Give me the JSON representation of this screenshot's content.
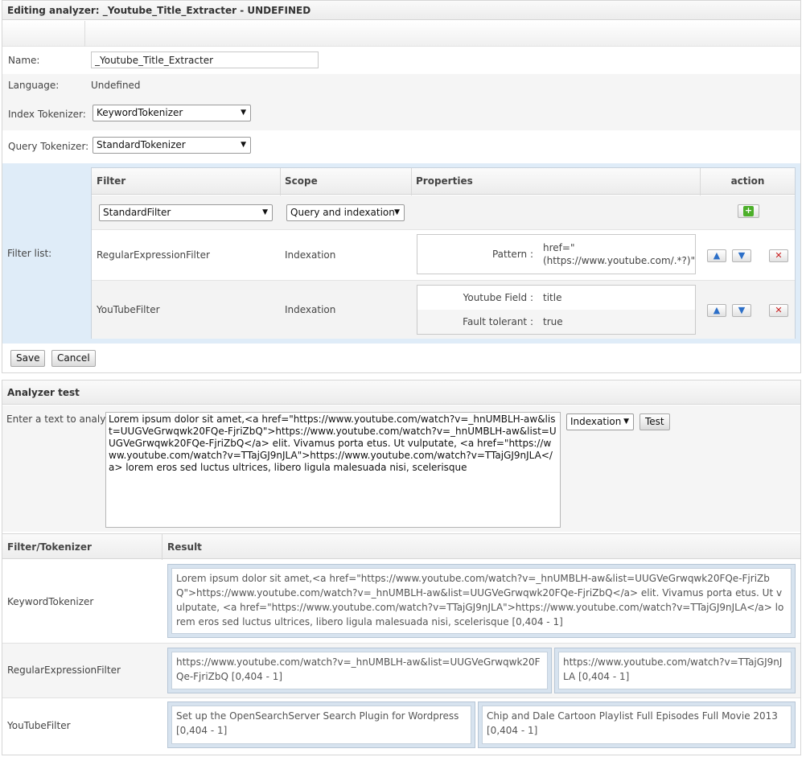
{
  "editor": {
    "title": "Editing analyzer: _Youtube_Title_Extracter - UNDEFINED",
    "name_label": "Name:",
    "name_value": "_Youtube_Title_Extracter",
    "language_label": "Language:",
    "language_value": "Undefined",
    "index_tokenizer_label": "Index Tokenizer:",
    "index_tokenizer_value": "KeywordTokenizer",
    "query_tokenizer_label": "Query Tokenizer:",
    "query_tokenizer_value": "StandardTokenizer",
    "filter_list_label": "Filter list:",
    "columns": {
      "filter": "Filter",
      "scope": "Scope",
      "properties": "Properties",
      "action": "action"
    },
    "new_filter": {
      "filter_value": "StandardFilter",
      "scope_value": "Query and indexation"
    },
    "filters": [
      {
        "name": "RegularExpressionFilter",
        "scope": "Indexation",
        "properties": [
          {
            "label": "Pattern :",
            "value": "href=\"(https://www.youtube.com/.*?)\""
          }
        ]
      },
      {
        "name": "YouTubeFilter",
        "scope": "Indexation",
        "properties": [
          {
            "label": "Youtube Field :",
            "value": "title"
          },
          {
            "label": "Fault tolerant :",
            "value": "true"
          }
        ]
      }
    ],
    "save_label": "Save",
    "cancel_label": "Cancel",
    "icons": {
      "add": "add-icon",
      "up": "arrow-up-icon",
      "down": "arrow-down-icon",
      "delete": "delete-icon"
    },
    "colors": {
      "filter_area": "#dfecf8",
      "delete": "#c81e1e",
      "add": "#4caf2a"
    }
  },
  "tester": {
    "title": "Analyzer test",
    "input_label": "Enter a text to analyze:",
    "input_text": "Lorem ipsum dolor sit amet,<a href=\"https://www.youtube.com/watch?v=_hnUMBLH-aw&list=UUGVeGrwqwk20FQe-FjriZbQ\">https://www.youtube.com/watch?v=_hnUMBLH-aw&list=UUGVeGrwqwk20FQe-FjriZbQ</a> elit. Vivamus porta etus. Ut vulputate, <a href=\"https://www.youtube.com/watch?v=TTajGJ9nJLA\">https://www.youtube.com/watch?v=TTajGJ9nJLA</a> lorem eros sed luctus ultrices, libero ligula malesuada nisi, scelerisque",
    "scope_value": "Indexation",
    "test_label": "Test",
    "columns": {
      "filter_tokenizer": "Filter/Tokenizer",
      "result": "Result"
    },
    "results": [
      {
        "name": "KeywordTokenizer",
        "tokens": [
          "Lorem ipsum dolor sit amet,<a href=\"https://www.youtube.com/watch?v=_hnUMBLH-aw&list=UUGVeGrwqwk20FQe-FjriZbQ\">https://www.youtube.com/watch?v=_hnUMBLH-aw&list=UUGVeGrwqwk20FQe-FjriZbQ</a> elit. Vivamus porta etus. Ut vulputate, <a href=\"https://www.youtube.com/watch?v=TTajGJ9nJLA\">https://www.youtube.com/watch?v=TTajGJ9nJLA</a> lorem eros sed luctus ultrices, libero ligula malesuada nisi, scelerisque [0,404 - 1]"
        ]
      },
      {
        "name": "RegularExpressionFilter",
        "tokens": [
          "https://www.youtube.com/watch?v=_hnUMBLH-aw&list=UUGVeGrwqwk20FQe-FjriZbQ [0,404 - 1]",
          "https://www.youtube.com/watch?v=TTajGJ9nJLA [0,404 - 1]"
        ]
      },
      {
        "name": "YouTubeFilter",
        "tokens": [
          "Set up the OpenSearchServer Search Plugin for Wordpress [0,404 - 1]",
          "Chip and Dale Cartoon Playlist Full Episodes Full Movie 2013 [0,404 - 1]"
        ]
      }
    ]
  }
}
